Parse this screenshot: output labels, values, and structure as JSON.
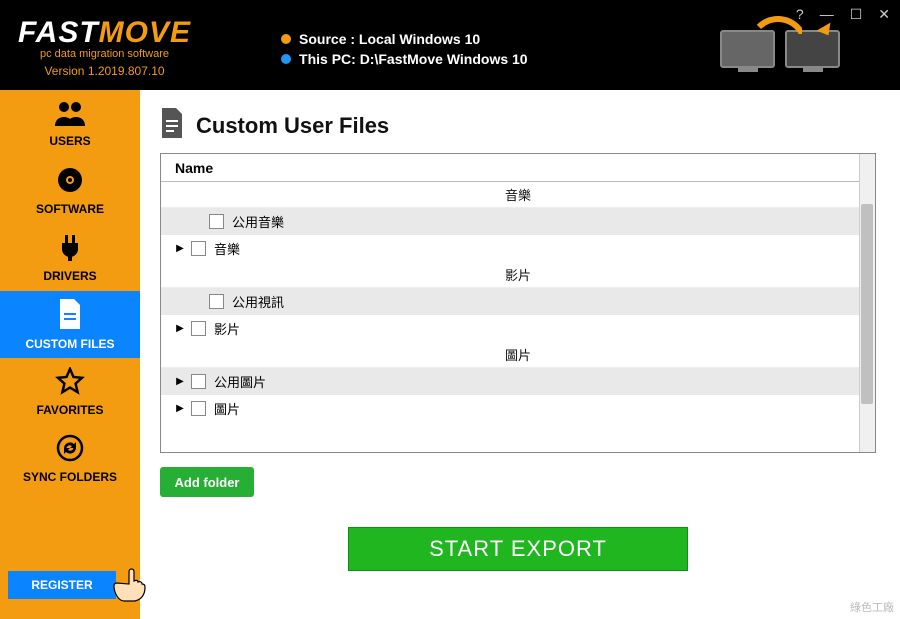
{
  "header": {
    "brand_fast": "FAST",
    "brand_move": "MOVE",
    "tagline": "pc data migration software",
    "version": "Version 1.2019.807.10",
    "source_label": "Source : Local Windows 10",
    "thispc_label": "This PC: D:\\FastMove Windows 10",
    "win_help": "?",
    "win_min": "—",
    "win_max": "☐",
    "win_close": "✕"
  },
  "sidebar": {
    "items": [
      {
        "label": "USERS",
        "icon": "users"
      },
      {
        "label": "SOFTWARE",
        "icon": "disc"
      },
      {
        "label": "DRIVERS",
        "icon": "plug"
      },
      {
        "label": "CUSTOM FILES",
        "icon": "file"
      },
      {
        "label": "FAVORITES",
        "icon": "star"
      },
      {
        "label": "SYNC FOLDERS",
        "icon": "sync"
      }
    ],
    "register": "REGISTER"
  },
  "main": {
    "title": "Custom User Files",
    "column": "Name",
    "categories": {
      "music": "音樂",
      "video": "影片",
      "pictures": "圖片"
    },
    "rows": [
      {
        "cat": "music_header"
      },
      {
        "label": "公用音樂",
        "indented": true,
        "striped": true,
        "expander": false
      },
      {
        "label": "音樂",
        "indented": false,
        "striped": false,
        "expander": true
      },
      {
        "cat": "video_header"
      },
      {
        "label": "公用視訊",
        "indented": true,
        "striped": true,
        "expander": false
      },
      {
        "label": "影片",
        "indented": false,
        "striped": false,
        "expander": true
      },
      {
        "cat": "pictures_header"
      },
      {
        "label": "公用圖片",
        "indented": false,
        "striped": true,
        "expander": true
      },
      {
        "label": "圖片",
        "indented": false,
        "striped": false,
        "expander": true
      }
    ],
    "add_folder": "Add folder",
    "export": "START EXPORT"
  },
  "watermark": "綠色工廠"
}
